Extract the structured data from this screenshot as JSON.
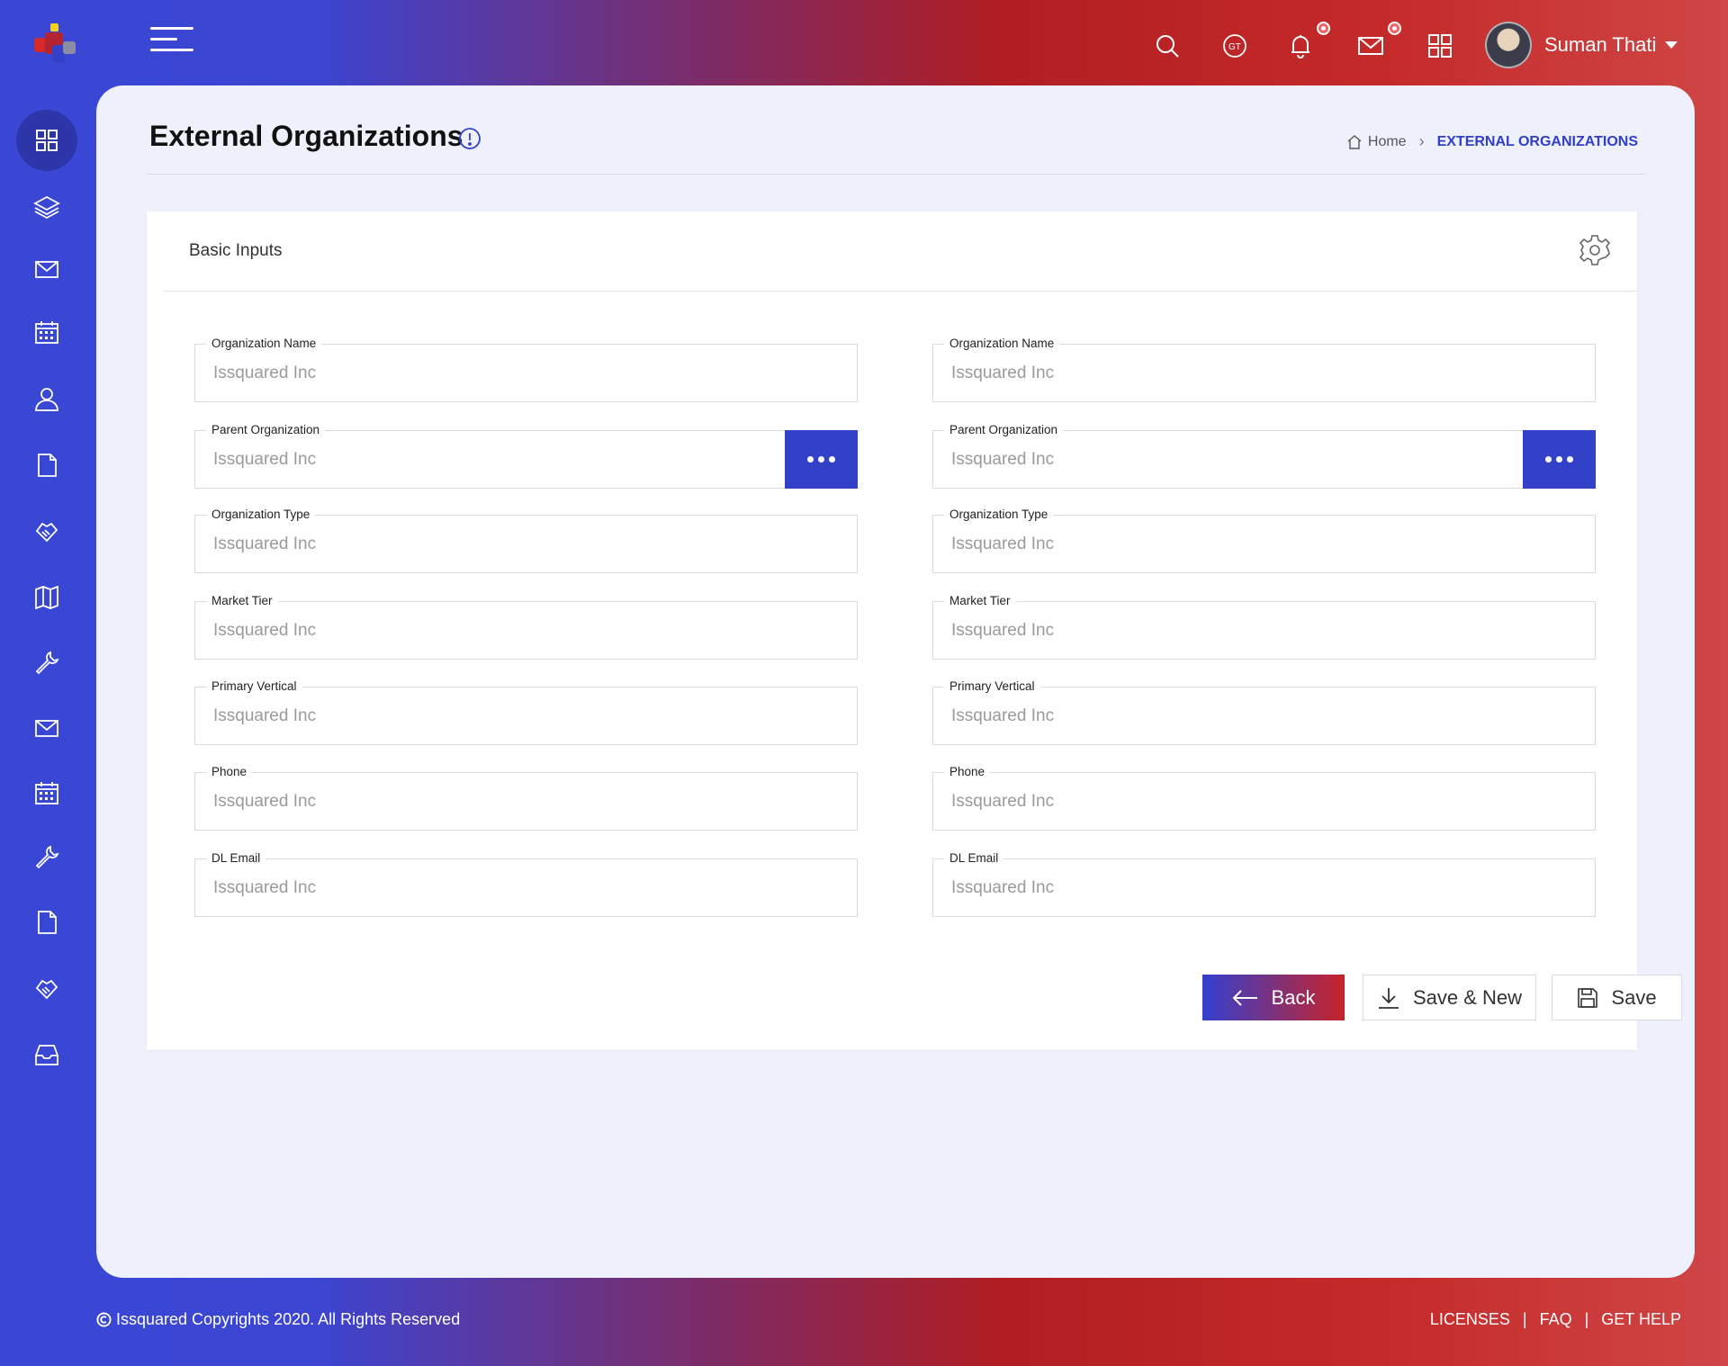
{
  "user": {
    "name": "Suman Thati"
  },
  "page": {
    "title": "External Organizations"
  },
  "breadcrumb": {
    "home": "Home",
    "current": "EXTERNAL ORGANIZATIONS"
  },
  "card": {
    "title": "Basic Inputs"
  },
  "form": {
    "left": [
      {
        "label": "Organization Name",
        "placeholder": "Issquared Inc"
      },
      {
        "label": "Parent Organization",
        "placeholder": "Issquared Inc"
      },
      {
        "label": "Organization Type",
        "placeholder": "Issquared Inc"
      },
      {
        "label": "Market Tier",
        "placeholder": "Issquared Inc"
      },
      {
        "label": "Primary Vertical",
        "placeholder": "Issquared Inc"
      },
      {
        "label": "Phone",
        "placeholder": "Issquared Inc"
      },
      {
        "label": "DL Email",
        "placeholder": "Issquared Inc"
      }
    ],
    "right": [
      {
        "label": "Organization Name",
        "placeholder": "Issquared Inc"
      },
      {
        "label": "Parent Organization",
        "placeholder": "Issquared Inc"
      },
      {
        "label": "Organization Type",
        "placeholder": "Issquared Inc"
      },
      {
        "label": "Market Tier",
        "placeholder": "Issquared Inc"
      },
      {
        "label": "Primary Vertical",
        "placeholder": "Issquared Inc"
      },
      {
        "label": "Phone",
        "placeholder": "Issquared Inc"
      },
      {
        "label": "DL Email",
        "placeholder": "Issquared Inc"
      }
    ]
  },
  "actions": {
    "back": "Back",
    "save_new": "Save & New",
    "save": "Save"
  },
  "footer": {
    "copyright": "Issquared Copyrights 2020. All Rights Reserved",
    "links": [
      "LICENSES",
      "FAQ",
      "GET HELP"
    ],
    "separator": "|"
  },
  "colors": {
    "primary": "#3341c9",
    "accent_red": "#c7232a",
    "surface": "#eef0fb"
  },
  "icons": {
    "sidebar": [
      "dashboard-icon",
      "layers-icon",
      "mail-icon",
      "calendar-icon",
      "user-icon",
      "file-icon",
      "handshake-icon",
      "map-icon",
      "wrench-icon",
      "mail-icon",
      "calendar-icon",
      "wrench-icon",
      "file-icon",
      "handshake-icon",
      "inbox-icon"
    ],
    "topbar": [
      "search-icon",
      "translate-icon",
      "bell-icon",
      "mail-icon",
      "apps-icon"
    ]
  }
}
